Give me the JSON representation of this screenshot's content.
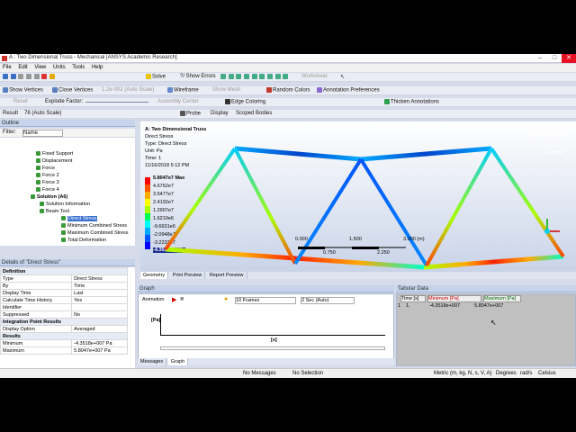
{
  "window": {
    "title": "A : Two Dimensional Truss - Mechanical [ANSYS Academic Research]",
    "minimize": "–",
    "maximize": "□",
    "close": "✕"
  },
  "menu": [
    "File",
    "Edit",
    "View",
    "Units",
    "Tools",
    "Help"
  ],
  "toolbar1": {
    "solve": "Solve",
    "show_errors": "?/ Show Errors",
    "worksheet": "Worksheet"
  },
  "toolbar2": {
    "show_vertices": "Show Vertices",
    "close_vertices": "Close Vertices",
    "scale": "1.2e-002 (Auto Scale)",
    "wireframe": "Wireframe",
    "show_mesh": "Show Mesh",
    "random_colors": "Random Colors",
    "annotation_prefs": "Annotation Preferences"
  },
  "toolbar3": {
    "reset": "Reset",
    "explode_factor": "Explode Factor:",
    "assembly_center": "Assembly Center",
    "edge_coloring": "Edge Coloring",
    "thicken_annotations": "Thicken Annotations"
  },
  "toolbar4": {
    "result_label": "Result",
    "result_value": "78 (Auto Scale)",
    "probe": "Probe",
    "display_label": "Display",
    "display_value": "Scoped Bodies"
  },
  "outline": {
    "header": "Outline",
    "filter_label": "Filter:",
    "filter_value": "Name",
    "items": [
      {
        "label": "Fixed Support"
      },
      {
        "label": "Displacement"
      },
      {
        "label": "Force"
      },
      {
        "label": "Force 2"
      },
      {
        "label": "Force 3"
      },
      {
        "label": "Force 4"
      },
      {
        "label": "Solution (A6)"
      },
      {
        "label": "Solution Information"
      },
      {
        "label": "Beam Tool"
      },
      {
        "label": "Direct Stress"
      },
      {
        "label": "Minimum Combined Stress"
      },
      {
        "label": "Maximum Combined Stress"
      },
      {
        "label": "Total Deformation"
      }
    ]
  },
  "details": {
    "header": "Details of \"Direct Stress\"",
    "sections": {
      "definition": "Definition",
      "integration": "Integration Point Results",
      "results": "Results"
    },
    "rows": {
      "type": [
        "Type",
        "Direct Stress"
      ],
      "by": [
        "By",
        "Time"
      ],
      "display_time": [
        "Display Time",
        "Last"
      ],
      "calc_hist": [
        "Calculate Time History",
        "Yes"
      ],
      "identifier": [
        "Identifier",
        ""
      ],
      "suppressed": [
        "Suppressed",
        "No"
      ],
      "display_option": [
        "Display Option",
        "Averaged"
      ],
      "minimum": [
        "Minimum",
        "-4.3518e+007 Pa"
      ],
      "maximum": [
        "Maximum",
        "5.8047e+007 Pa"
      ]
    }
  },
  "viewport": {
    "info": {
      "title": "A: Two Dimensional Truss",
      "result": "Direct Stress",
      "type": "Type: Direct Stress",
      "unit": "Unit: Pa",
      "time": "Time: 1",
      "date": "11/16/2018 5:12 PM"
    },
    "legend": {
      "max": "5.8047e7 Max",
      "values": [
        "4.6762e7",
        "3.5477e7",
        "2.4192e7",
        "1.2907e7",
        "1.6219e6",
        "-9.6631e6",
        "-2.0948e7",
        "-3.2233e7"
      ],
      "min": "-4.3518e7 Min",
      "colors": [
        "#ff0000",
        "#ff5500",
        "#ffaa00",
        "#ffff00",
        "#aaff00",
        "#00ff55",
        "#00ffff",
        "#00aaff",
        "#0055ff",
        "#0000ff"
      ]
    },
    "brand": {
      "name": "ANSYS",
      "version": "R17.1",
      "edition": "Academic"
    },
    "scale": {
      "a": "0.000",
      "b": "1.500",
      "c": "3.000 (m)",
      "d": "0.750",
      "e": "2.250"
    },
    "tabs": [
      "Geometry",
      "Print Preview",
      "Report Preview"
    ]
  },
  "graph": {
    "header": "Graph",
    "animation": "Animation",
    "frames": "10 Frames",
    "duration": "2 Sec (Auto)",
    "y_unit": "[Pa]",
    "x_unit": "[s]",
    "tabs": [
      "Messages",
      "Graph"
    ]
  },
  "tabular": {
    "header": "Tabular Data",
    "columns": [
      "Time [s]",
      "Minimum [Pa]",
      "Maximum [Pa]"
    ],
    "rows": [
      [
        "1",
        "1.",
        "-4.3518e+007",
        "5.8047e+007"
      ]
    ]
  },
  "status": {
    "messages": "No Messages",
    "selection": "No Selection",
    "units": "Metric (m, kg, N, s, V, A)",
    "angle": "Degrees",
    "rate": "rad/s",
    "temp": "Celsius"
  }
}
